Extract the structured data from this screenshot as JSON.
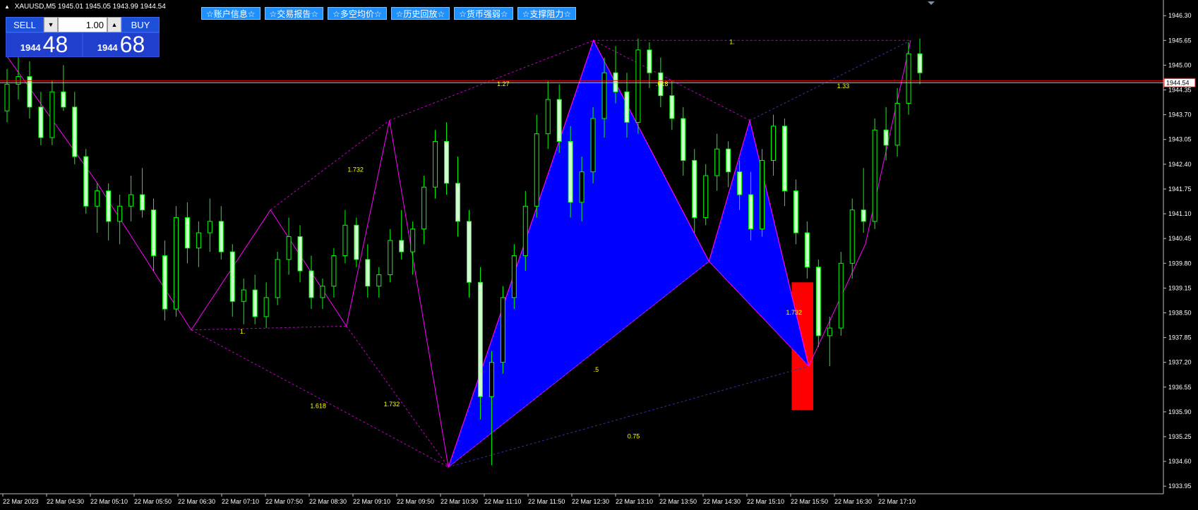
{
  "window": {
    "title": "XAUUSD,M5  1945.01 1945.05 1943.99 1944.54"
  },
  "trade_panel": {
    "sell_label": "SELL",
    "buy_label": "BUY",
    "lot_value": "1.00",
    "sell_price_prefix": "1944",
    "sell_price_big": "48",
    "buy_price_prefix": "1944",
    "buy_price_big": "68"
  },
  "toolbar": {
    "buttons": [
      "☆账户信息☆",
      "☆交易报告☆",
      "☆多空均价☆",
      "☆历史回放☆",
      "☆货币强弱☆",
      "☆支撑阻力☆"
    ]
  },
  "colors": {
    "bull_candle": "#00ff00",
    "bear_candle": "#ccffcc",
    "pattern_fill": "#0000ff",
    "zigzag": "#ff00ff",
    "fib_label": "#ffff00",
    "target_zone": "#ff0000",
    "bid_line": "#ff0000"
  },
  "chart_data": {
    "type": "candlestick",
    "symbol": "XAUUSD",
    "timeframe": "M5",
    "current_price": "1944.54",
    "y_ticks": [
      "1946.30",
      "1945.65",
      "1945.00",
      "1944.35",
      "1943.70",
      "1943.05",
      "1942.40",
      "1941.75",
      "1941.10",
      "1940.45",
      "1939.80",
      "1939.15",
      "1938.50",
      "1937.85",
      "1937.20",
      "1936.55",
      "1935.90",
      "1935.25",
      "1934.60",
      "1933.95"
    ],
    "x_ticks": [
      "22 Mar 2023",
      "22 Mar 04:30",
      "22 Mar 05:10",
      "22 Mar 05:50",
      "22 Mar 06:30",
      "22 Mar 07:10",
      "22 Mar 07:50",
      "22 Mar 08:30",
      "22 Mar 09:10",
      "22 Mar 09:50",
      "22 Mar 10:30",
      "22 Mar 11:10",
      "22 Mar 11:50",
      "22 Mar 12:30",
      "22 Mar 13:10",
      "22 Mar 13:50",
      "22 Mar 14:30",
      "22 Mar 15:10",
      "22 Mar 15:50",
      "22 Mar 16:30",
      "22 Mar 17:10"
    ],
    "ylim": [
      1933.75,
      1946.6
    ],
    "zigzag": [
      {
        "t": "03:52",
        "price": 1945.25
      },
      {
        "t": "05:10",
        "price": 1942.0
      },
      {
        "t": "06:35",
        "price": 1938.05
      },
      {
        "t": "07:45",
        "price": 1941.2
      },
      {
        "t": "08:52",
        "price": 1938.15
      },
      {
        "t": "09:30",
        "price": 1943.55
      },
      {
        "t": "10:22",
        "price": 1934.45
      },
      {
        "t": "12:30",
        "price": 1945.65
      },
      {
        "t": "14:12",
        "price": 1939.85
      },
      {
        "t": "14:48",
        "price": 1943.55
      },
      {
        "t": "15:40",
        "price": 1937.1
      },
      {
        "t": "16:30",
        "price": 1940.3
      },
      {
        "t": "17:10",
        "price": 1945.65
      }
    ],
    "harmonic_patterns": [
      {
        "points": [
          {
            "t": "10:22",
            "price": 1934.45
          },
          {
            "t": "12:30",
            "price": 1945.65
          },
          {
            "t": "14:12",
            "price": 1939.85
          }
        ]
      },
      {
        "points": [
          {
            "t": "14:12",
            "price": 1939.85
          },
          {
            "t": "14:48",
            "price": 1943.55
          },
          {
            "t": "15:40",
            "price": 1937.1
          }
        ]
      }
    ],
    "target_zone": {
      "t_start": "15:25",
      "t_end": "15:44",
      "price_high": 1939.3,
      "price_low": 1935.95
    },
    "labels": [
      {
        "text": "1.732",
        "t": "08:53",
        "price": 1942.2
      },
      {
        "text": "1.",
        "t": "07:18",
        "price": 1937.95
      },
      {
        "text": "1.618",
        "t": "08:20",
        "price": 1936.0
      },
      {
        "text": "1.732",
        "t": "09:25",
        "price": 1936.05
      },
      {
        "text": "1.27",
        "t": "11:05",
        "price": 1944.45
      },
      {
        "text": "1.",
        "t": "14:30",
        "price": 1945.55
      },
      {
        "text": ".618",
        "t": "13:25",
        "price": 1944.45
      },
      {
        "text": "1.33",
        "t": "16:05",
        "price": 1944.4
      },
      {
        "text": "1.732",
        "t": "15:20",
        "price": 1938.45
      },
      {
        "text": ".5",
        "t": "12:30",
        "price": 1936.95
      },
      {
        "text": "0.75",
        "t": "13:00",
        "price": 1935.2
      }
    ],
    "candles": [
      [
        1943.8,
        1944.9,
        1943.5,
        1944.5
      ],
      [
        1944.5,
        1945.3,
        1944.1,
        1944.7
      ],
      [
        1944.7,
        1945.1,
        1943.6,
        1943.9
      ],
      [
        1943.9,
        1944.3,
        1942.9,
        1943.1
      ],
      [
        1943.1,
        1944.6,
        1942.9,
        1944.3
      ],
      [
        1944.3,
        1945.0,
        1943.8,
        1943.9
      ],
      [
        1943.9,
        1944.3,
        1942.4,
        1942.6
      ],
      [
        1942.6,
        1942.8,
        1941.1,
        1941.3
      ],
      [
        1941.3,
        1941.9,
        1940.6,
        1941.7
      ],
      [
        1941.7,
        1941.9,
        1940.4,
        1940.9
      ],
      [
        1940.9,
        1941.6,
        1940.3,
        1941.3
      ],
      [
        1941.3,
        1942.1,
        1940.9,
        1941.6
      ],
      [
        1941.6,
        1942.3,
        1941.0,
        1941.2
      ],
      [
        1941.2,
        1941.5,
        1939.6,
        1940.0
      ],
      [
        1940.0,
        1940.4,
        1938.3,
        1938.6
      ],
      [
        1938.6,
        1941.3,
        1938.4,
        1941.0
      ],
      [
        1941.0,
        1941.4,
        1939.8,
        1940.2
      ],
      [
        1940.2,
        1940.9,
        1939.7,
        1940.6
      ],
      [
        1940.6,
        1941.5,
        1940.1,
        1940.9
      ],
      [
        1940.9,
        1941.3,
        1939.9,
        1940.1
      ],
      [
        1940.1,
        1940.3,
        1938.4,
        1938.8
      ],
      [
        1938.8,
        1939.4,
        1938.2,
        1939.1
      ],
      [
        1939.1,
        1939.5,
        1938.2,
        1938.4
      ],
      [
        1938.4,
        1939.3,
        1938.1,
        1938.9
      ],
      [
        1938.9,
        1940.1,
        1938.7,
        1939.9
      ],
      [
        1939.9,
        1941.0,
        1939.5,
        1940.5
      ],
      [
        1940.5,
        1940.8,
        1939.3,
        1939.6
      ],
      [
        1939.6,
        1940.0,
        1938.6,
        1938.9
      ],
      [
        1938.9,
        1939.4,
        1938.6,
        1939.2
      ],
      [
        1939.2,
        1940.2,
        1938.9,
        1940.0
      ],
      [
        1940.0,
        1941.2,
        1939.8,
        1940.8
      ],
      [
        1940.8,
        1941.0,
        1939.7,
        1939.9
      ],
      [
        1939.9,
        1940.3,
        1938.9,
        1939.2
      ],
      [
        1939.2,
        1939.7,
        1938.9,
        1939.5
      ],
      [
        1939.5,
        1940.7,
        1939.3,
        1940.4
      ],
      [
        1940.4,
        1941.2,
        1939.9,
        1940.1
      ],
      [
        1940.1,
        1940.9,
        1939.5,
        1940.7
      ],
      [
        1940.7,
        1942.1,
        1940.3,
        1941.8
      ],
      [
        1941.8,
        1943.3,
        1941.5,
        1943.0
      ],
      [
        1943.0,
        1943.5,
        1941.6,
        1941.9
      ],
      [
        1941.9,
        1942.6,
        1940.5,
        1940.9
      ],
      [
        1940.9,
        1941.2,
        1938.9,
        1939.3
      ],
      [
        1939.3,
        1939.7,
        1935.7,
        1936.3
      ],
      [
        1936.3,
        1937.5,
        1934.5,
        1937.2
      ],
      [
        1937.2,
        1939.2,
        1936.9,
        1938.9
      ],
      [
        1938.9,
        1940.3,
        1938.6,
        1940.0
      ],
      [
        1940.0,
        1941.7,
        1939.6,
        1941.3
      ],
      [
        1941.3,
        1943.7,
        1941.0,
        1943.2
      ],
      [
        1943.2,
        1944.6,
        1942.8,
        1944.1
      ],
      [
        1944.1,
        1944.5,
        1942.7,
        1943.0
      ],
      [
        1943.0,
        1943.4,
        1941.0,
        1941.4
      ],
      [
        1941.4,
        1942.6,
        1940.9,
        1942.2
      ],
      [
        1942.2,
        1943.9,
        1941.9,
        1943.6
      ],
      [
        1943.6,
        1945.2,
        1943.1,
        1944.8
      ],
      [
        1944.8,
        1945.5,
        1944.0,
        1944.3
      ],
      [
        1944.3,
        1944.8,
        1943.1,
        1943.5
      ],
      [
        1943.5,
        1945.7,
        1943.2,
        1945.4
      ],
      [
        1945.4,
        1945.6,
        1944.4,
        1944.8
      ],
      [
        1944.8,
        1945.2,
        1943.9,
        1944.2
      ],
      [
        1944.2,
        1944.6,
        1943.3,
        1943.6
      ],
      [
        1943.6,
        1943.9,
        1942.1,
        1942.5
      ],
      [
        1942.5,
        1942.8,
        1940.6,
        1941.0
      ],
      [
        1941.0,
        1942.4,
        1940.8,
        1942.1
      ],
      [
        1942.1,
        1943.2,
        1941.7,
        1942.8
      ],
      [
        1942.8,
        1943.0,
        1941.8,
        1942.2
      ],
      [
        1942.2,
        1942.5,
        1941.2,
        1941.6
      ],
      [
        1941.6,
        1942.2,
        1940.4,
        1940.7
      ],
      [
        1940.7,
        1942.8,
        1940.5,
        1942.5
      ],
      [
        1942.5,
        1943.7,
        1942.1,
        1943.4
      ],
      [
        1943.4,
        1943.6,
        1941.3,
        1941.7
      ],
      [
        1941.7,
        1942.0,
        1940.3,
        1940.6
      ],
      [
        1940.6,
        1940.9,
        1939.4,
        1939.7
      ],
      [
        1939.7,
        1939.9,
        1937.6,
        1937.9
      ],
      [
        1937.9,
        1938.4,
        1937.1,
        1938.1
      ],
      [
        1938.1,
        1940.1,
        1937.9,
        1939.8
      ],
      [
        1939.8,
        1941.5,
        1939.4,
        1941.2
      ],
      [
        1941.2,
        1942.3,
        1940.6,
        1940.9
      ],
      [
        1940.9,
        1943.6,
        1940.7,
        1943.3
      ],
      [
        1943.3,
        1943.9,
        1942.5,
        1942.9
      ],
      [
        1942.9,
        1944.4,
        1942.6,
        1944.0
      ],
      [
        1944.0,
        1945.6,
        1943.7,
        1945.3
      ],
      [
        1945.3,
        1945.7,
        1944.5,
        1944.8
      ]
    ]
  }
}
